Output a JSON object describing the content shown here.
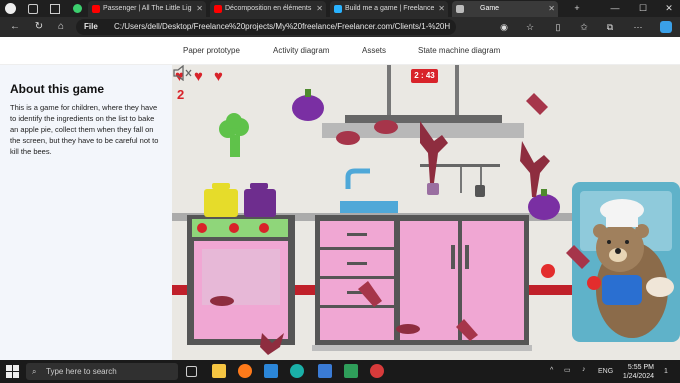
{
  "browser": {
    "tabs": [
      {
        "label": "Passenger | All The Little Lights",
        "color": "#ff0000"
      },
      {
        "label": "Décomposition en éléments s…",
        "color": "#ff0000"
      },
      {
        "label": "Build me a game | Freelancer",
        "color": "#29b2fe"
      },
      {
        "label": "Game",
        "color": "#bbbbbb"
      }
    ],
    "address_scheme": "File",
    "url": "C:/Users/dell/Desktop/Freelance%20projects/My%20freelance/Freelancer.com/Clients/1-%20HT..."
  },
  "topnav": {
    "links": [
      "Paper prototype",
      "Activity diagram",
      "Assets",
      "State machine diagram"
    ]
  },
  "sidebar": {
    "title": "About this game",
    "description": "This is a game for children, where they have to identify the ingredients on the list to bake an apple pie, collect them when they fall on the screen, but they have to be careful not to kill the bees."
  },
  "game": {
    "hearts": 3,
    "score": "2",
    "timer": "2 : 43",
    "accent_color": "#d8232a",
    "falling_items": [
      "eggplant",
      "broccoli",
      "meat",
      "cleaver",
      "wine-glass",
      "apple",
      "spoon"
    ]
  },
  "taskbar": {
    "search_placeholder": "Type here to search",
    "language": "ENG",
    "time": "5:55 PM",
    "date": "1/24/2024",
    "notification_count": "1"
  }
}
